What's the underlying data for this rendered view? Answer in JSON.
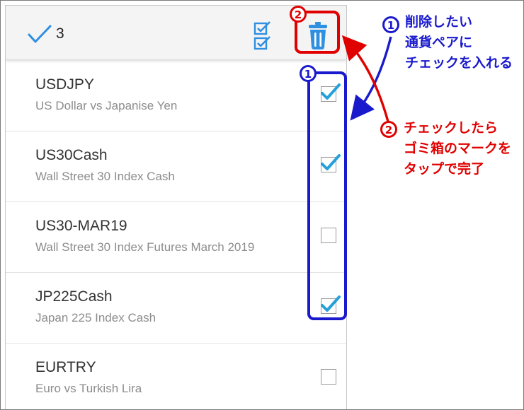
{
  "toolbar": {
    "selected_count": "3",
    "icons": {
      "done": "checkmark-icon",
      "select_all": "select-all-icon",
      "delete": "trash-icon"
    }
  },
  "instruments": [
    {
      "symbol": "USDJPY",
      "description": "US Dollar vs Japanise Yen",
      "checked": true
    },
    {
      "symbol": "US30Cash",
      "description": "Wall Street 30 Index Cash",
      "checked": true
    },
    {
      "symbol": "US30-MAR19",
      "description": "Wall Street 30 Index Futures March 2019",
      "checked": false
    },
    {
      "symbol": "JP225Cash",
      "description": "Japan 225 Index Cash",
      "checked": true
    },
    {
      "symbol": "EURTRY",
      "description": "Euro vs Turkish Lira",
      "checked": false
    }
  ],
  "annotations": {
    "step1": {
      "number": "1",
      "lines": [
        "削除したい",
        "通貨ペアに",
        "チェックを入れる"
      ],
      "color": "#1a1acd"
    },
    "step2": {
      "number": "2",
      "lines": [
        "チェックしたら",
        "ゴミ箱のマークを",
        "タップで完了"
      ],
      "color": "#e00000"
    }
  },
  "colors": {
    "accent": "#2f8fe0",
    "checkmark": "#26a0d8",
    "annotation_blue": "#1a1acd",
    "annotation_red": "#e00000"
  }
}
